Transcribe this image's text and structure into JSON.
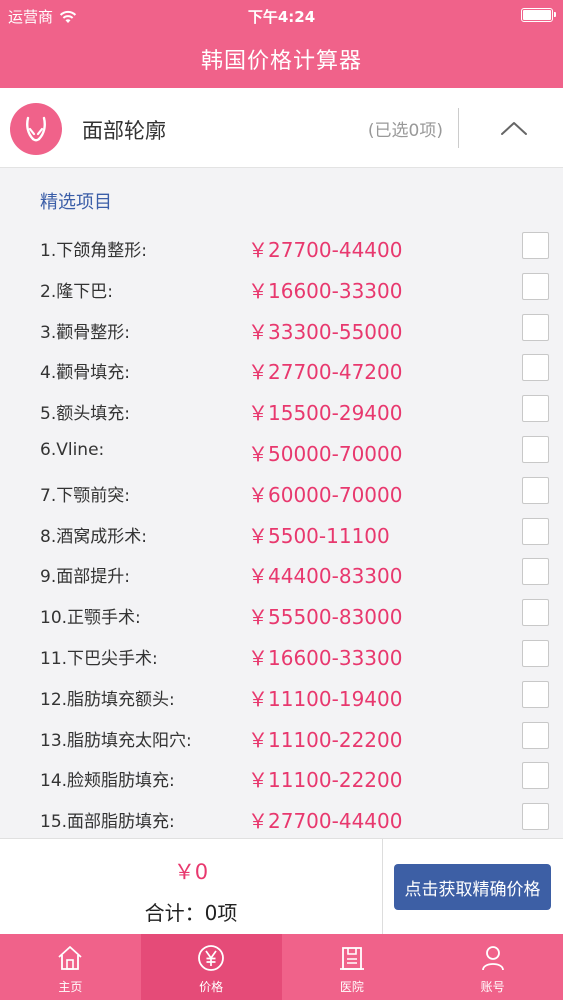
{
  "status": {
    "carrier": "运营商",
    "time": "下午4:24"
  },
  "nav": {
    "title": "韩国价格计算器"
  },
  "category": {
    "title": "面部轮廓",
    "selected": "(已选0项)",
    "icon": "face-icon",
    "collapse_icon": "chevron-up-icon"
  },
  "list": {
    "section_title": "精选项目",
    "items": [
      {
        "name": "1.下颌角整形:",
        "price": "￥27700-44400"
      },
      {
        "name": "2.隆下巴:",
        "price": "￥16600-33300"
      },
      {
        "name": "3.颧骨整形:",
        "price": "￥33300-55000"
      },
      {
        "name": "4.颧骨填充:",
        "price": "￥27700-47200"
      },
      {
        "name": "5.额头填充:",
        "price": "￥15500-29400"
      },
      {
        "name": "6.Vline:",
        "price": "￥50000-70000"
      },
      {
        "name": "7.下颚前突:",
        "price": "￥60000-70000"
      },
      {
        "name": "8.酒窝成形术:",
        "price": "￥5500-11100"
      },
      {
        "name": "9.面部提升:",
        "price": "￥44400-83300"
      },
      {
        "name": "10.正颚手术:",
        "price": "￥55500-83000"
      },
      {
        "name": "11.下巴尖手术:",
        "price": "￥16600-33300"
      },
      {
        "name": "12.脂肪填充额头:",
        "price": "￥11100-19400"
      },
      {
        "name": "13.脂肪填充太阳穴:",
        "price": "￥11100-22200"
      },
      {
        "name": "14.脸颊脂肪填充:",
        "price": "￥11100-22200"
      },
      {
        "name": "15.面部脂肪填充:",
        "price": "￥27700-44400"
      }
    ]
  },
  "footer": {
    "total_money": "￥0",
    "total_count": "合计：0项",
    "button_label": "点击获取精确价格"
  },
  "tabs": [
    {
      "label": "主页",
      "icon": "home-icon",
      "active": false
    },
    {
      "label": "价格",
      "icon": "yen-icon",
      "active": true
    },
    {
      "label": "医院",
      "icon": "hospital-icon",
      "active": false
    },
    {
      "label": "账号",
      "icon": "user-icon",
      "active": false
    }
  ],
  "colors": {
    "brand_pink": "#f0628a",
    "price_pink": "#e8386e",
    "button_blue": "#3d5fa5",
    "section_blue": "#3b5ea8"
  }
}
